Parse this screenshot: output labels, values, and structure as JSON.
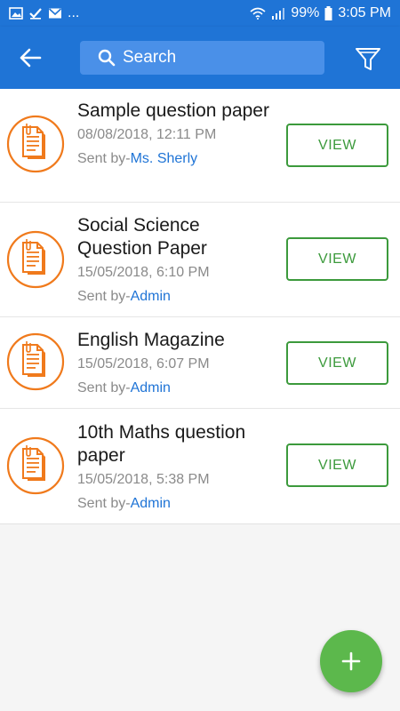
{
  "status_bar": {
    "left_icons": [
      "gallery-icon",
      "check-icon",
      "mail-icon"
    ],
    "overflow": "...",
    "battery": "99%",
    "time": "3:05 PM"
  },
  "app_bar": {
    "back_icon": "arrow-left-icon",
    "search_placeholder": "Search",
    "filter_icon": "funnel-icon",
    "color": "#1f74d6"
  },
  "items": [
    {
      "title": "Sample question paper",
      "date": "08/08/2018,  12:11 PM",
      "sent_by_label": "Sent by-",
      "sender": "Ms. Sherly",
      "action": "VIEW"
    },
    {
      "title": "Social Science Question Paper",
      "date": "15/05/2018,  6:10 PM",
      "sent_by_label": "Sent by-",
      "sender": "Admin",
      "action": "VIEW"
    },
    {
      "title": "English Magazine",
      "date": "15/05/2018,  6:07 PM",
      "sent_by_label": "Sent by-",
      "sender": "Admin",
      "action": "VIEW"
    },
    {
      "title": "10th Maths question paper",
      "date": "15/05/2018,  5:38 PM",
      "sent_by_label": "Sent by-",
      "sender": "Admin",
      "action": "VIEW"
    }
  ],
  "fab": {
    "label": "+",
    "icon": "plus-icon",
    "color": "#5cb84c"
  },
  "colors": {
    "accent": "#1f74d6",
    "view_green": "#3c9a3c",
    "doc_orange": "#f07a1c"
  }
}
